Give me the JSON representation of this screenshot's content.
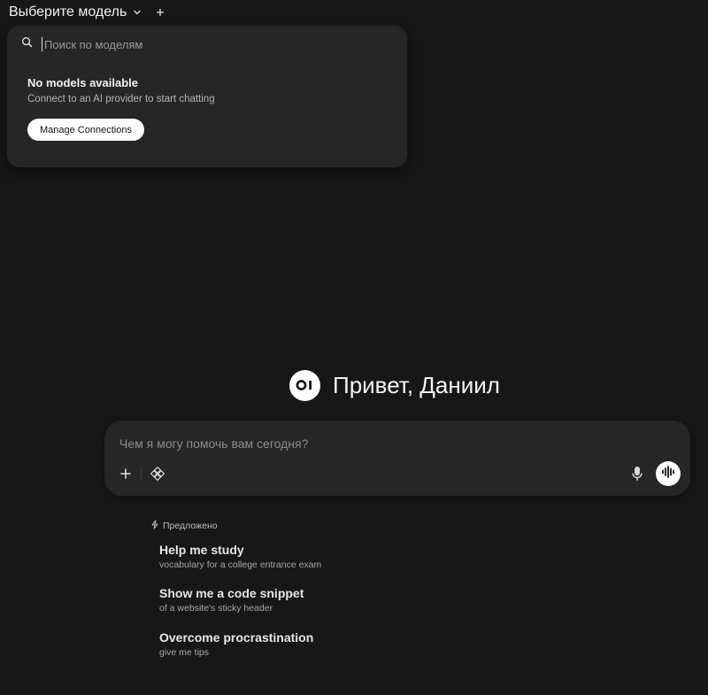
{
  "header": {
    "model_selector_label": "Выберите модель",
    "chevron_icon": "chevron-down-icon",
    "add_icon": "plus-icon"
  },
  "dropdown": {
    "search_placeholder": "Поиск по моделям",
    "search_value": "",
    "empty_title": "No models available",
    "empty_subtitle": "Connect to an AI provider to start chatting",
    "manage_button": "Manage Connections"
  },
  "greeting": {
    "logo_text": "OI",
    "text": "Привет, Даниил"
  },
  "composer": {
    "placeholder": "Чем я могу помочь вам сегодня?",
    "value": "",
    "icons": [
      "plus-icon",
      "tools-icon",
      "microphone-icon",
      "voice-waveform-icon"
    ]
  },
  "suggestions": {
    "header": "Предложено",
    "items": [
      {
        "title": "Help me study",
        "subtitle": "vocabulary for a college entrance exam"
      },
      {
        "title": "Show me a code snippet",
        "subtitle": "of a website's sticky header"
      },
      {
        "title": "Overcome procrastination",
        "subtitle": "give me tips"
      }
    ]
  },
  "colors": {
    "background": "#171717",
    "panel": "#262626",
    "accent_white": "#ffffff"
  }
}
